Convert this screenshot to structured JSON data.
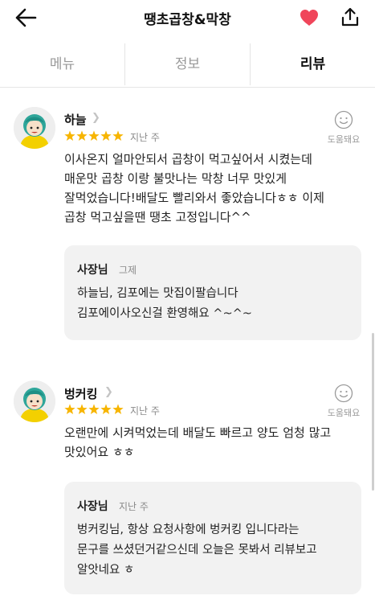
{
  "header": {
    "title": "땡초곱창&막창",
    "back_icon": "arrow-left-icon",
    "favorite_icon": "heart-icon",
    "favorite_color": "#f0455a",
    "share_icon": "share-icon"
  },
  "tabs": [
    {
      "label": "메뉴",
      "active": false
    },
    {
      "label": "정보",
      "active": false
    },
    {
      "label": "리뷰",
      "active": true
    }
  ],
  "reviews": [
    {
      "name": "하늘",
      "rating": 5,
      "date": "지난 주",
      "helpful_label": "도움돼요",
      "text": [
        "이사온지 얼마안되서 곱창이 먹고싶어서 시켰는데",
        "매운맛 곱창 이랑 불맛나는 막창 너무 맛있게",
        "잘먹었습니다!배달도 빨리와서 좋았습니다ㅎㅎ 이제",
        "곱창 먹고싶을땐 땡초 고정입니다^^"
      ],
      "reply": {
        "owner": "사장님",
        "date": "그제",
        "text": [
          "하늘님, 김포에는 맛집이팔습니다",
          "김포에이사오신걸 환영해요 ^~^~"
        ]
      }
    },
    {
      "name": "벙커킹",
      "rating": 5,
      "date": "지난 주",
      "helpful_label": "도움돼요",
      "text": [
        "오랜만에 시켜먹었는데 배달도 빠르고 양도 엄청 많고",
        "맛있어요 ㅎㅎ"
      ],
      "reply": {
        "owner": "사장님",
        "date": "지난 주",
        "text": [
          "벙커킹님, 항상 요청사항에 벙커킹 입니다라는",
          "문구를 쓰셨던거같으신데 오늘은 못봐서 리뷰보고",
          "알앗네요 ㅎ"
        ]
      }
    }
  ],
  "colors": {
    "star": "#f7b500",
    "reply_bg": "#f2f2f2",
    "avatar_hair": "#2fa69a",
    "avatar_body": "#f3d000"
  }
}
